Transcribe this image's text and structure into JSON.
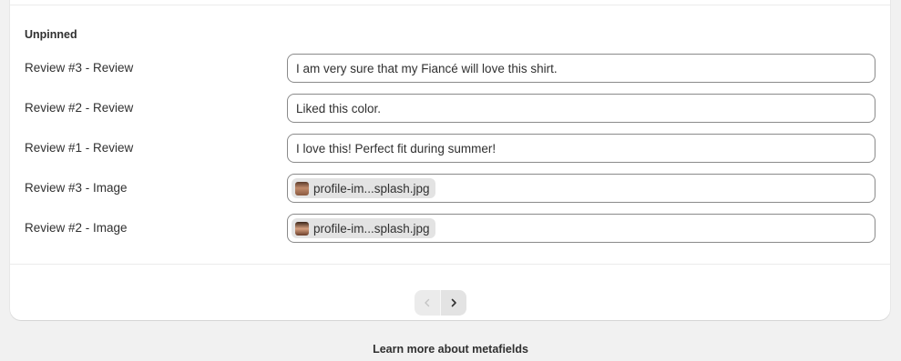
{
  "section": {
    "title": "Unpinned"
  },
  "rows": [
    {
      "label": "Review #3 - Review",
      "value": "I am very sure that my Fiancé will love this shirt."
    },
    {
      "label": "Review #2 - Review",
      "value": "Liked this color."
    },
    {
      "label": "Review #1 - Review",
      "value": "I love this! Perfect fit during summer!"
    },
    {
      "label": "Review #3 - Image",
      "file_name": "profile-im...splash.jpg",
      "thumb_icon": "photo-thumbnail"
    },
    {
      "label": "Review #2 - Image",
      "file_name": "profile-im...splash.jpg",
      "thumb_icon": "photo-thumbnail"
    }
  ],
  "pagination": {
    "prev_icon": "chevron-left-icon",
    "next_icon": "chevron-right-icon",
    "prev_disabled": true
  },
  "footer": {
    "link": "Learn more about metafields"
  },
  "colors": {
    "background": "#f1f1f1",
    "card": "#ffffff",
    "field_border": "#8a8a8a",
    "chip": "#e3e3e3"
  }
}
